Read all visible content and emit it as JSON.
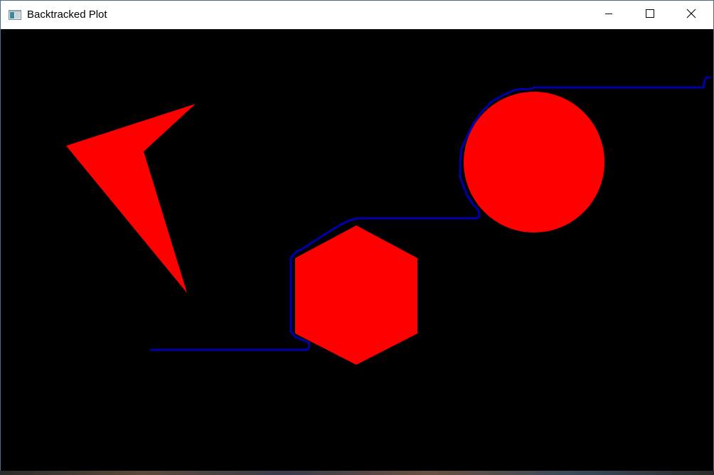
{
  "window": {
    "title": "Backtracked Plot",
    "icon": "app-window-icon"
  },
  "controls": {
    "minimize_icon": "minimize-icon",
    "maximize_icon": "maximize-icon",
    "close_icon": "close-icon"
  },
  "colors": {
    "obstacle": "#ff0000",
    "path": "#0000aa",
    "background": "#000000"
  }
}
